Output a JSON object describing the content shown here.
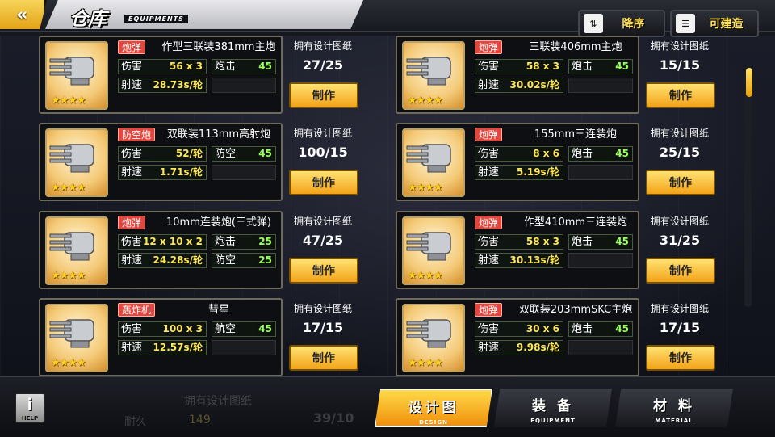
{
  "header": {
    "title": "仓库",
    "subtitle": "EQUIPMENTS",
    "back_icon": "«",
    "sort_label": "降序",
    "sort_icon": "⇅",
    "build_label": "可建造",
    "build_icon": "☰"
  },
  "side_label": "拥有设计图纸",
  "make_label": "制作",
  "items": [
    {
      "tag": "炮弹",
      "name": "作型三联装381mm主炮",
      "stats": [
        {
          "l": "伤害",
          "v": "56 x 3"
        },
        {
          "l": "炮击",
          "v": "45"
        },
        {
          "l": "射速",
          "v": "28.73s/轮"
        },
        {
          "l": "",
          "v": ""
        }
      ],
      "count": "27/25",
      "stars": "★★★★"
    },
    {
      "tag": "炮弹",
      "name": "三联装406mm主炮",
      "stats": [
        {
          "l": "伤害",
          "v": "58 x 3"
        },
        {
          "l": "炮击",
          "v": "45"
        },
        {
          "l": "射速",
          "v": "30.02s/轮"
        },
        {
          "l": "",
          "v": ""
        }
      ],
      "count": "15/15",
      "stars": "★★★★"
    },
    {
      "tag": "防空炮",
      "name": "双联装113mm高射炮",
      "stats": [
        {
          "l": "伤害",
          "v": "52/轮"
        },
        {
          "l": "防空",
          "v": "45"
        },
        {
          "l": "射速",
          "v": "1.71s/轮"
        },
        {
          "l": "",
          "v": ""
        }
      ],
      "count": "100/15",
      "stars": "★★★★"
    },
    {
      "tag": "炮弹",
      "name": "155mm三连装炮",
      "stats": [
        {
          "l": "伤害",
          "v": "8 x 6"
        },
        {
          "l": "炮击",
          "v": "45"
        },
        {
          "l": "射速",
          "v": "5.19s/轮"
        },
        {
          "l": "",
          "v": ""
        }
      ],
      "count": "25/15",
      "stars": "★★★★"
    },
    {
      "tag": "炮弹",
      "name": "10mm连装炮(三式弹)",
      "stats": [
        {
          "l": "伤害",
          "v": "12 x 10 x 2"
        },
        {
          "l": "炮击",
          "v": "25"
        },
        {
          "l": "射速",
          "v": "24.28s/轮"
        },
        {
          "l": "防空",
          "v": "25"
        }
      ],
      "count": "47/25",
      "stars": "★★★★"
    },
    {
      "tag": "炮弹",
      "name": "作型410mm三连装炮",
      "stats": [
        {
          "l": "伤害",
          "v": "58 x 3"
        },
        {
          "l": "炮击",
          "v": "45"
        },
        {
          "l": "射速",
          "v": "30.13s/轮"
        },
        {
          "l": "",
          "v": ""
        }
      ],
      "count": "31/25",
      "stars": "★★★★"
    },
    {
      "tag": "轰炸机",
      "name": "彗星",
      "stats": [
        {
          "l": "伤害",
          "v": "100 x 3"
        },
        {
          "l": "航空",
          "v": "45"
        },
        {
          "l": "射速",
          "v": "12.57s/轮"
        },
        {
          "l": "",
          "v": ""
        }
      ],
      "count": "17/15",
      "stars": "★★★★"
    },
    {
      "tag": "炮弹",
      "name": "双联装203mmSKC主炮",
      "stats": [
        {
          "l": "伤害",
          "v": "30 x 6"
        },
        {
          "l": "炮击",
          "v": "45"
        },
        {
          "l": "射速",
          "v": "9.98s/轮"
        },
        {
          "l": "",
          "v": ""
        }
      ],
      "count": "17/15",
      "stars": "★★★★"
    }
  ],
  "ghost": {
    "a": "拥有设计图纸",
    "b": "39/10",
    "c": "耐久",
    "d": "149"
  },
  "bottom": {
    "help": "i",
    "help_label": "HELP",
    "tab1": "设计图",
    "tab1_en": "DESIGN",
    "tab2": "装 备",
    "tab2_en": "EQUIPMENT",
    "tab3": "材 料",
    "tab3_en": "MATERIAL"
  }
}
